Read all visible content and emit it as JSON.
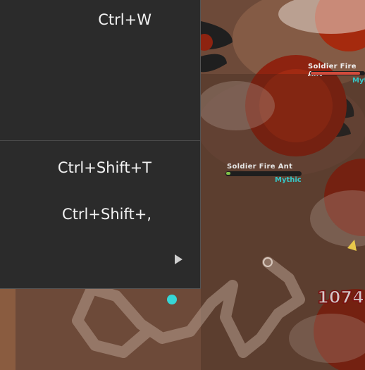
{
  "context_menu": {
    "items": [
      {
        "shortcut": "Ctrl+W"
      },
      {
        "shortcut": "Ctrl+Shift+T"
      },
      {
        "shortcut": "Ctrl+Shift+,"
      }
    ]
  },
  "game": {
    "mobs": [
      {
        "name": "Soldier Fire Ant",
        "rarity": "Mythic"
      },
      {
        "name": "Soldier Fire Ant",
        "rarity": "Mythic"
      }
    ],
    "damage_number": "1074",
    "colors": {
      "background": "#6b4838",
      "menu_bg": "#2b2b2b",
      "rarity_mythic": "#36c6c6",
      "health": "#d14b3c"
    }
  }
}
